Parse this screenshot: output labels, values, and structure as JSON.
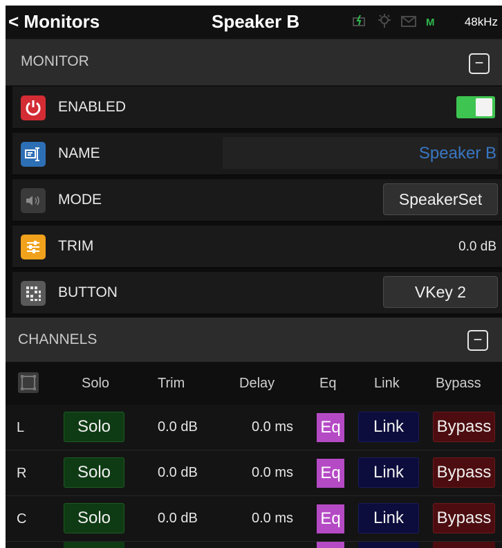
{
  "header": {
    "back_label": "< Monitors",
    "title": "Speaker B",
    "status_flag": "M",
    "sample_rate": "48kHz"
  },
  "monitor_section": {
    "label": "MONITOR",
    "collapse_symbol": "−"
  },
  "rows": {
    "enabled": {
      "label": "ENABLED",
      "value": true
    },
    "name": {
      "label": "NAME",
      "value": "Speaker B"
    },
    "mode": {
      "label": "MODE",
      "value": "SpeakerSet"
    },
    "trim": {
      "label": "TRIM",
      "value": "0.0 dB"
    },
    "button": {
      "label": "BUTTON",
      "value": "VKey 2"
    }
  },
  "channels_section": {
    "label": "CHANNELS",
    "collapse_symbol": "−"
  },
  "columns": {
    "solo": "Solo",
    "trim": "Trim",
    "delay": "Delay",
    "eq": "Eq",
    "link": "Link",
    "bypass": "Bypass"
  },
  "channels": [
    {
      "name": "L",
      "solo": "Solo",
      "trim": "0.0 dB",
      "delay": "0.0 ms",
      "eq": "Eq",
      "link": "Link",
      "bypass": "Bypass"
    },
    {
      "name": "R",
      "solo": "Solo",
      "trim": "0.0 dB",
      "delay": "0.0 ms",
      "eq": "Eq",
      "link": "Link",
      "bypass": "Bypass"
    },
    {
      "name": "C",
      "solo": "Solo",
      "trim": "0.0 dB",
      "delay": "0.0 ms",
      "eq": "Eq",
      "link": "Link",
      "bypass": "Bypass"
    }
  ],
  "colors": {
    "accent_green": "#3ec450",
    "name_blue": "#3977c2",
    "eq_purple": "#b54ac5",
    "solo_green": "#0f3b14",
    "link_navy": "#0c0c3d",
    "bypass_red": "#4d0d10"
  }
}
